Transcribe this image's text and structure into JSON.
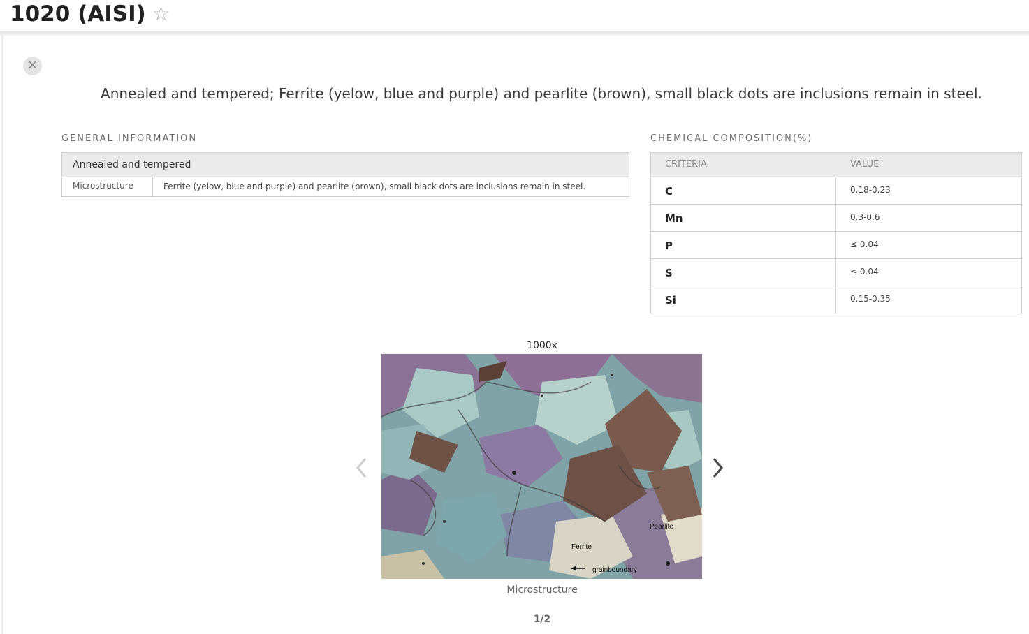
{
  "header": {
    "title": "1020 (AISI)",
    "favorite_icon": "star-icon"
  },
  "panel": {
    "close_icon": "close-icon",
    "headline": "Annealed and tempered; Ferrite (yelow, blue and purple) and pearlite (brown), small black dots are inclusions remain in steel."
  },
  "general_info": {
    "section_label": "GENERAL INFORMATION",
    "heading": "Annealed and tempered",
    "rows": [
      {
        "key": "Microstructure",
        "value": "Ferrite (yelow, blue and purple) and pearlite (brown), small black dots are inclusions remain in steel."
      }
    ]
  },
  "chemical_composition": {
    "section_label": "CHEMICAL COMPOSITION(%)",
    "columns": [
      "CRITERIA",
      "VALUE"
    ],
    "rows": [
      {
        "criteria": "C",
        "value": "0.18-0.23"
      },
      {
        "criteria": "Mn",
        "value": "0.3-0.6"
      },
      {
        "criteria": "P",
        "value": "≤ 0.04"
      },
      {
        "criteria": "S",
        "value": "≤ 0.04"
      },
      {
        "criteria": "Si",
        "value": "0.15-0.35"
      }
    ]
  },
  "gallery": {
    "magnification": "1000x",
    "image_labels": {
      "pearlite": "Pearlite",
      "ferrite": "Ferrite",
      "grainboundary": "grainboundary"
    },
    "caption": "Microstructure",
    "pager": "1/2",
    "prev_icon": "chevron-left-icon",
    "next_icon": "chevron-right-icon"
  }
}
